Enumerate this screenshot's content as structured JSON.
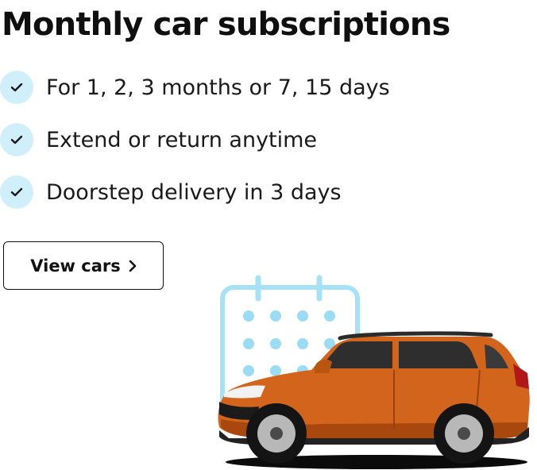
{
  "hero": {
    "title": "Monthly car subscriptions"
  },
  "features": [
    {
      "text": "For 1, 2, 3 months or 7, 15 days",
      "icon": "check-icon"
    },
    {
      "text": "Extend or return anytime",
      "icon": "check-icon"
    },
    {
      "text": "Doorstep delivery in 3 days",
      "icon": "check-icon"
    }
  ],
  "cta": {
    "label": "View cars",
    "icon": "chevron-right-icon"
  },
  "colors": {
    "check_bg": "#cfeffa",
    "calendar": "#a7e1f6",
    "calendar_dots": "#9bdcf4",
    "car_body": "#d2651b",
    "text": "#111111"
  }
}
